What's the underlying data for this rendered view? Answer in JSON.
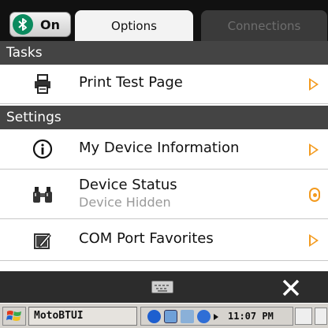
{
  "header": {
    "bluetooth_toggle_label": "On",
    "tabs": [
      {
        "label": "Options",
        "active": true
      },
      {
        "label": "Connections",
        "active": false
      }
    ]
  },
  "sections": [
    {
      "title": "Tasks",
      "items": [
        {
          "label": "Print Test Page",
          "icon": "printer-icon",
          "indicator": "chevron-right-icon"
        }
      ]
    },
    {
      "title": "Settings",
      "items": [
        {
          "label": "My Device Information",
          "icon": "info-icon",
          "indicator": "chevron-right-icon"
        },
        {
          "label": "Device Status",
          "sublabel": "Device Hidden",
          "icon": "binoculars-icon",
          "indicator": "status-indicator-icon"
        },
        {
          "label": "COM Port Favorites",
          "icon": "favorites-icon",
          "indicator": "chevron-right-icon"
        }
      ]
    }
  ],
  "softkeys": {
    "left_icon": "keyboard-icon",
    "right_icon": "close-icon"
  },
  "taskbar": {
    "app_label": "MotoBTUI",
    "clock": "11:07 PM"
  },
  "colors": {
    "accent_orange": "#f39a1e",
    "bluetooth_green": "#0b8a5e",
    "section_header_bg": "#444444",
    "tabbar_bg": "#111111"
  }
}
